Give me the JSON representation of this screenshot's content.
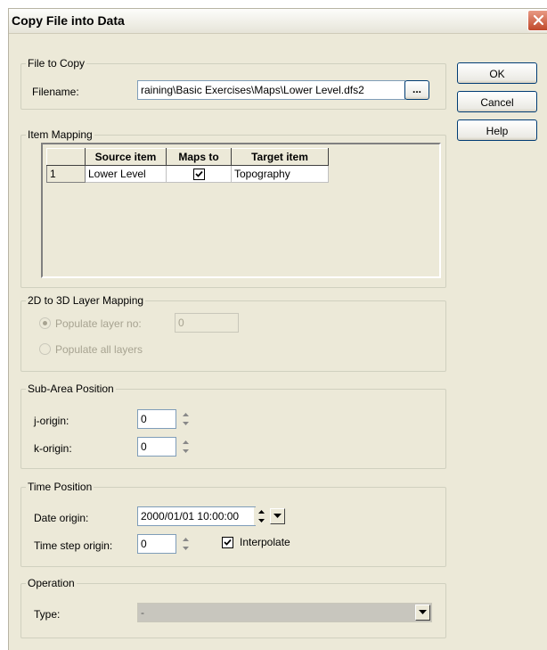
{
  "window": {
    "title": "Copy File into Data"
  },
  "file_to_copy": {
    "legend": "File to Copy",
    "filename_label": "Filename:",
    "filename_value": "raining\\Basic Exercises\\Maps\\Lower Level.dfs2",
    "browse_label": "..."
  },
  "buttons": {
    "ok": "OK",
    "cancel": "Cancel",
    "help": "Help"
  },
  "item_mapping": {
    "legend": "Item Mapping",
    "columns": [
      "Source item",
      "Maps to",
      "Target item"
    ],
    "rows": [
      {
        "num": "1",
        "source": "Lower Level",
        "maps_to": true,
        "target": "Topography"
      }
    ]
  },
  "layer_mapping": {
    "legend": "2D to 3D Layer Mapping",
    "populate_layer_label": "Populate layer no:",
    "populate_layer_value": "0",
    "populate_all_label": "Populate all layers"
  },
  "sub_area": {
    "legend": "Sub-Area Position",
    "j_label": "j-origin:",
    "j_value": "0",
    "k_label": "k-origin:",
    "k_value": "0"
  },
  "time_position": {
    "legend": "Time Position",
    "date_label": "Date origin:",
    "date_value": "2000/01/01 10:00:00",
    "timestep_label": "Time step origin:",
    "timestep_value": "0",
    "interpolate_label": "Interpolate"
  },
  "operation": {
    "legend": "Operation",
    "type_label": "Type:",
    "type_value": "-"
  }
}
